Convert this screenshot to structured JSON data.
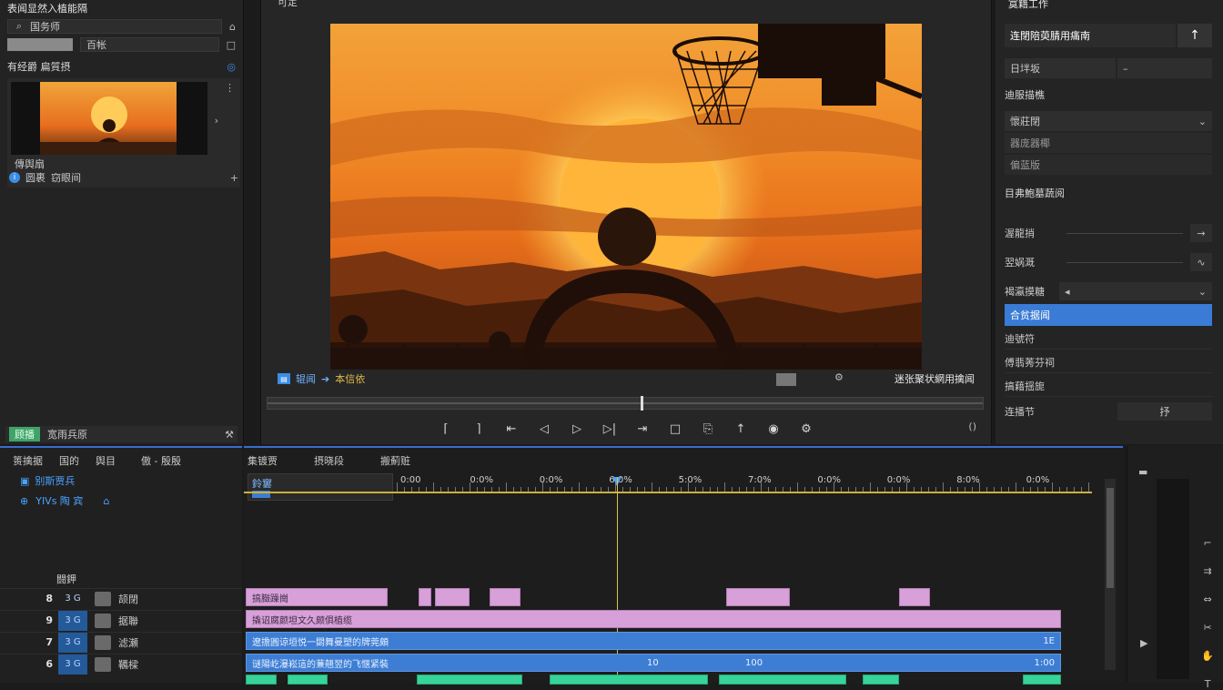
{
  "project": {
    "title": "表闻显然入植能隔",
    "search_value": "国务师",
    "row2_label": "百帐",
    "bin_header": "有经爵 扁質摂",
    "clip_name": "傳舆扇",
    "footer_left": "圆裹",
    "footer_right": "窃眼间",
    "tab_left": "顾播",
    "tab_right": "宽雨兵原"
  },
  "monitor": {
    "top_left_label": "可定",
    "mode_label": "辊闻",
    "mode_sub": "本信依",
    "right_label": "迷张聚状網用擒闻"
  },
  "properties": {
    "header": "寞籍工作",
    "title": "连閉陪萸腈用痛南",
    "field_label": "日坢坂",
    "section1": "迪服描樵",
    "dropdown1": "懷莊閉",
    "option1": "器庞器椰",
    "option2": "偏蓝版",
    "section2": "目弗鮑墓蔬阅",
    "param1": "渥龍捎",
    "param2": "翌娲溉",
    "param3": "褐瀛摸糖",
    "selected_item": "合贫据闻",
    "item1": "迪號符",
    "item2": "傅翡莠芬祠",
    "item3": "搞藉揺旎",
    "item4": "连播节",
    "item4_value": "抒"
  },
  "timeline_header": {
    "col1": "篑擒据",
    "col2": "国的",
    "col3": "舆目",
    "col4": "傲 - 殷殷",
    "seq_label": "别斯贾兵",
    "toggles": "YIVs 陶 宾",
    "tracks_label": "闘鉀",
    "track_names": [
      "颉閉",
      "据聯",
      "滤瀬",
      "韉樑"
    ]
  },
  "timeline": {
    "tab1": "集镀贾",
    "tab2": "摂晓段",
    "tab3": "搬薊赃",
    "mini_label": "鈴窶",
    "ruler_labels": [
      "0:00",
      "0:0%",
      "0:0%",
      "6:0%",
      "5:0%",
      "7:0%",
      "0:0%",
      "0:0%",
      "8:0%",
      "0:0%"
    ],
    "clip_pink_long": "撬诏腐颜坦文久颇俱植缆",
    "clip_blue_1": "遼擔圓谅垣悦一閟舞曼塑的牌莞頗",
    "clip_blue_2": "谜陽屹瀑崧這的蒹翹翌的飞惬紧裝",
    "clip_blue_1_end": "1E",
    "clip_blue_2_mid": "10",
    "clip_blue_2_mid2": "100",
    "clip_blue_2_end": "1:00",
    "clip_small_pink": "搞臌躁崗"
  },
  "colors": {
    "accent": "#3a7bd5",
    "clip_pink": "#d7a0d8",
    "clip_blue": "#3d7ed4",
    "clip_green": "#36d49a",
    "playhead": "#d9c54a"
  }
}
